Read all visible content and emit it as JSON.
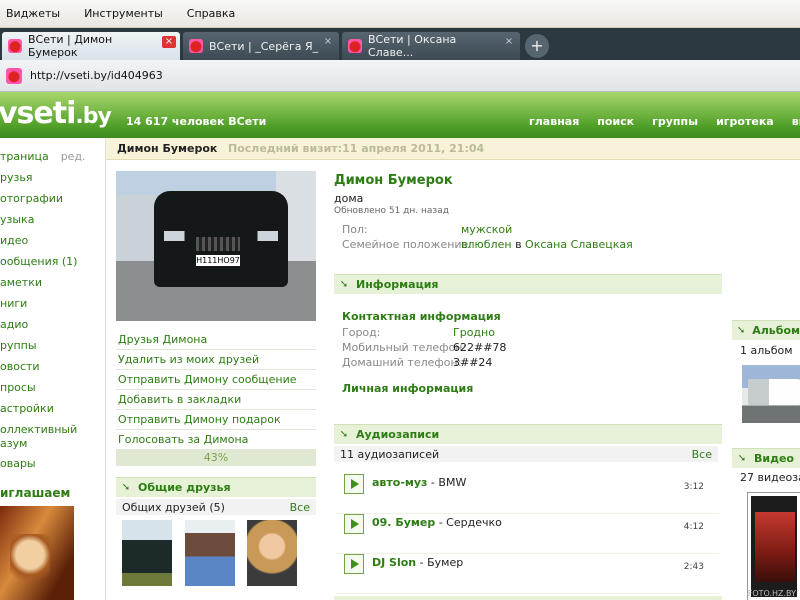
{
  "browser": {
    "menu": [
      "Виджеты",
      "Инструменты",
      "Справка"
    ],
    "tabs": [
      {
        "label": "ВСети | Димон Бумерок",
        "active": true
      },
      {
        "label": "ВСети | _Серёга Я_",
        "active": false
      },
      {
        "label": "ВСети | Оксана Славе...",
        "active": false
      }
    ],
    "new_tab_symbol": "+",
    "close_symbol": "×",
    "url": "http://vseti.by/id404963"
  },
  "site": {
    "logo_main": "vseti",
    "logo_tld": ".by",
    "online_count": "14 617 человек ВСети",
    "nav": [
      "главная",
      "поиск",
      "группы",
      "игротека",
      "вый"
    ]
  },
  "subbar": {
    "profile_name": "Димон Бумерок",
    "last_visit": "Последний визит:11 апреля 2011, 21:04"
  },
  "sidebar": {
    "items": [
      {
        "label": "траница",
        "extra": "ред."
      },
      {
        "label": "рузья"
      },
      {
        "label": "отографии"
      },
      {
        "label": "узыка"
      },
      {
        "label": "идео"
      },
      {
        "label": "ообщения (1)"
      },
      {
        "label": "аметки"
      },
      {
        "label": "ниги"
      },
      {
        "label": "адио"
      },
      {
        "label": "руппы"
      },
      {
        "label": "овости"
      },
      {
        "label": "просы"
      },
      {
        "label": "астройки"
      },
      {
        "label": "оллективный",
        "label2": "азум"
      },
      {
        "label": "овары"
      }
    ],
    "invite_title": "иглашаем"
  },
  "avatar": {
    "plate_text": "Н111НО97"
  },
  "actions": [
    "Друзья Димона",
    "Удалить из моих друзей",
    "Отправить Димону сообщение",
    "Добавить в закладки",
    "Отправить Димону подарок",
    "Голосовать за Димона"
  ],
  "rating": {
    "label": "43%",
    "value": 0.43
  },
  "common_friends": {
    "title": "Общие друзья",
    "count_label": "Общих друзей (5)",
    "all": "Все"
  },
  "profile": {
    "name": "Димон Бумерок",
    "status": "дома",
    "updated": "Обновлено 51 дн. назад",
    "gender_key": "Пол:",
    "gender_val": "мужской",
    "family_key": "Семейное положение:",
    "family_val": "влюблен",
    "family_in": "в",
    "family_partner": "Оксана Славецкая"
  },
  "info": {
    "title": "Информация",
    "contact_title": "Контактная информация",
    "city_key": "Город:",
    "city_val": "Гродно",
    "mobile_key": "Мобильный телефон:",
    "mobile_val": "622##78",
    "home_key": "Домашний телефон:",
    "home_val": "3##24",
    "personal_title": "Личная информация"
  },
  "audio": {
    "title": "Аудиозаписи",
    "count_label": "11 аудиозаписей",
    "all": "Все",
    "tracks": [
      {
        "artist": "авто-муз",
        "dash": " - ",
        "song": "BMW",
        "duration": "3:12"
      },
      {
        "artist": "09. Бумер",
        "dash": " - ",
        "song": "Сердечко",
        "duration": "4:12"
      },
      {
        "artist": "DJ Slon",
        "dash": " - ",
        "song": "Бумер",
        "duration": "2:43"
      }
    ]
  },
  "albums": {
    "title": "Альбом",
    "count_label": "1 альбом"
  },
  "video": {
    "title": "Видео",
    "count_label": "27 видеозап"
  },
  "watermark": "FOTO.HZ.BY",
  "colors": {
    "accent": "#2e7c14",
    "header_green": "#4f9f28",
    "tab_dark": "#2d3940"
  }
}
